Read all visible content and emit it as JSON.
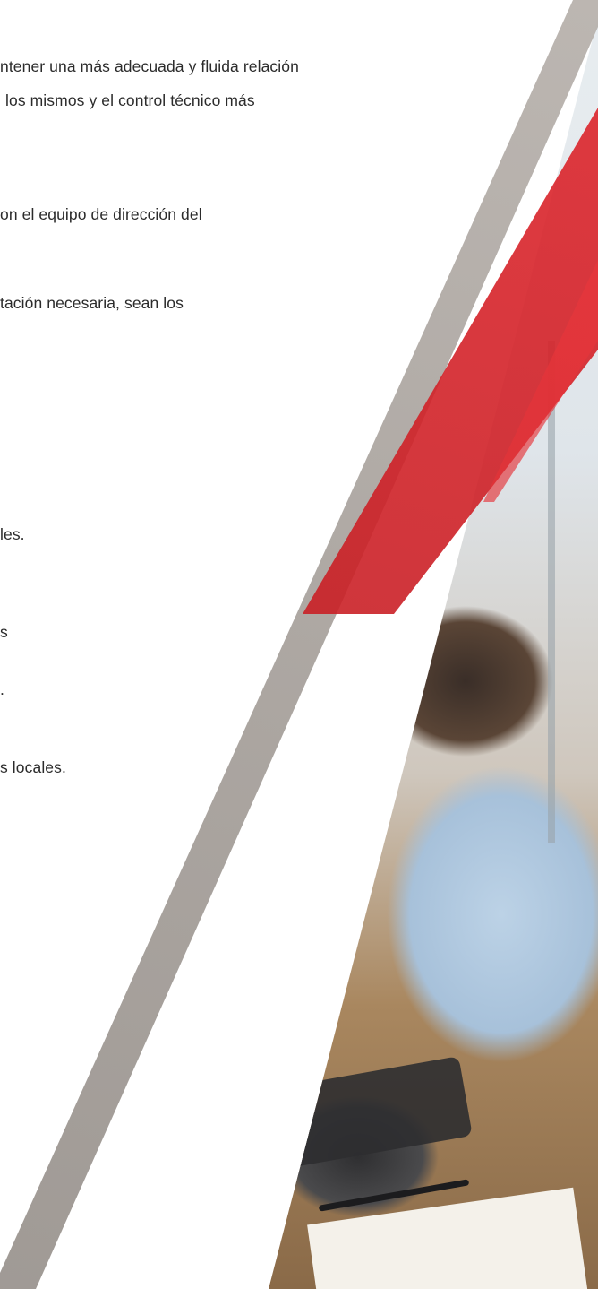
{
  "text_lines": [
    "ntener una más adecuada y fluida relación",
    "los mismos y el control técnico más",
    "on el equipo de dirección del",
    "tación necesaria, sean los",
    "les.",
    "s",
    ".",
    "s locales."
  ],
  "colors": {
    "text": "#2b2b2b",
    "grey_band": "#a8a29d",
    "red_accent": "#d1242a",
    "background": "#ffffff"
  }
}
